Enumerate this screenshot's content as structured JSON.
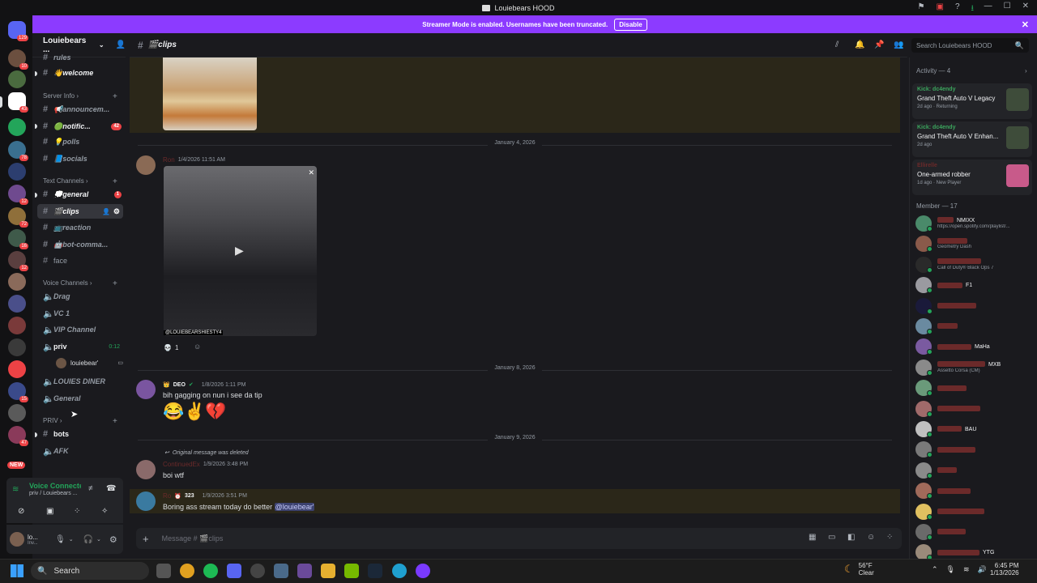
{
  "window": {
    "title": "Louiebears HOOD",
    "icons": [
      "pin-icon",
      "overlay-icon",
      "help-icon",
      "download-icon"
    ],
    "controls": [
      "minimize-icon",
      "maximize-icon",
      "close-icon"
    ]
  },
  "banner": {
    "text": "Streamer Mode is enabled. Usernames have been truncated.",
    "button": "Disable"
  },
  "rail": {
    "home_badge": "129",
    "badges": [
      "10",
      "43",
      "78",
      "12",
      "72",
      "16",
      "12",
      "15",
      "NEW",
      "47"
    ]
  },
  "server": {
    "name": "Louiebears ..."
  },
  "channels": {
    "top": [
      {
        "label": "rules"
      },
      {
        "label": "👋welcome"
      }
    ],
    "cat_info": "Server Info",
    "info": [
      {
        "label": "📢announcem..."
      },
      {
        "label": "🟢notific...",
        "badge": "42"
      },
      {
        "label": "💡polls"
      },
      {
        "label": "📘socials"
      }
    ],
    "cat_text": "Text Channels",
    "text": [
      {
        "label": "💭general",
        "badge": "1"
      },
      {
        "label": "🎬clips"
      },
      {
        "label": "📺reaction"
      },
      {
        "label": "🤖bot-comma..."
      },
      {
        "label": "face"
      }
    ],
    "cat_voice": "Voice Channels",
    "voice": [
      {
        "label": "Drag"
      },
      {
        "label": "VC 1"
      },
      {
        "label": "VIP Channel"
      },
      {
        "label": "priv",
        "time": "0:12"
      },
      {
        "label": "LOUIES DINER"
      },
      {
        "label": "General"
      }
    ],
    "voice_user": "louiebear'",
    "cat_priv": "PRIV",
    "priv": [
      {
        "label": "bots"
      },
      {
        "label": "AFK"
      }
    ]
  },
  "voice_panel": {
    "status": "Voice Connected",
    "sub": "priv / Louiebears ..."
  },
  "user_panel": {
    "name": "lo...",
    "status": "Inv..."
  },
  "header": {
    "channel": "🎬clips",
    "search_placeholder": "Search Louiebears HOOD"
  },
  "messages": {
    "date1": "January 4, 2026",
    "m1": {
      "time": "1/4/2026 11:51 AM",
      "reaction_count": "1",
      "video_caption": "@LOUIEBEARSHIESTY4"
    },
    "date2": "January 8, 2026",
    "m2": {
      "tag": "DEO",
      "time": "1/8/2026 1:11 PM",
      "text": "bih gagging on nun i see da tip",
      "emojis": "😂✌️💔"
    },
    "date3": "January 9, 2026",
    "m3": {
      "reply": "Original message was deleted",
      "time": "1/9/2026 3:48 PM",
      "text": "boi wtf"
    },
    "m4": {
      "tag": "323",
      "time": "1/9/2026 3:51 PM",
      "text": "Boring ass stream today do better ",
      "mention": "@louiebear'"
    }
  },
  "composer": {
    "placeholder": "Message # 🎬clips"
  },
  "activity": {
    "title": "Activity — 4",
    "items": [
      {
        "source": "Kick: dc4endy",
        "game": "Grand Theft Auto V Legacy",
        "meta": "2d ago · Returning"
      },
      {
        "source": "Kick: dc4endy",
        "game": "Grand Theft Auto V Enhan...",
        "meta": "2d ago"
      },
      {
        "source": "",
        "game": "One-armed robber",
        "meta": "1d ago · New Player"
      }
    ]
  },
  "members": {
    "title": "Member — 17",
    "list": [
      {
        "tag": "NMIXX",
        "sub": "https://open.spotify.com/playlist/..."
      },
      {
        "tag": "",
        "sub": "Geometry Dash"
      },
      {
        "tag": "",
        "sub": "Call of Duty® Black Ops 7"
      },
      {
        "tag": "F1",
        "sub": ""
      },
      {
        "tag": "",
        "sub": ""
      },
      {
        "tag": "",
        "sub": ""
      },
      {
        "tag": "MaHa",
        "sub": ""
      },
      {
        "tag": "MXB",
        "sub": "Assetto Corsa (CM)"
      },
      {
        "tag": "",
        "sub": ""
      },
      {
        "tag": "",
        "sub": ""
      },
      {
        "tag": "BAU",
        "sub": ""
      },
      {
        "tag": "",
        "sub": ""
      },
      {
        "tag": "",
        "sub": ""
      },
      {
        "tag": "",
        "sub": ""
      },
      {
        "tag": "",
        "sub": ""
      },
      {
        "tag": "",
        "sub": ""
      },
      {
        "tag": "YTG",
        "sub": ""
      }
    ]
  },
  "taskbar": {
    "search": "Search",
    "weather_temp": "56°F",
    "weather_cond": "Clear",
    "time": "6:45 PM",
    "date": "1/13/2026"
  },
  "colors": {
    "accent": "#8c3bff",
    "danger": "#ed4245",
    "online": "#23a55a",
    "kick": "#3ba55d"
  }
}
